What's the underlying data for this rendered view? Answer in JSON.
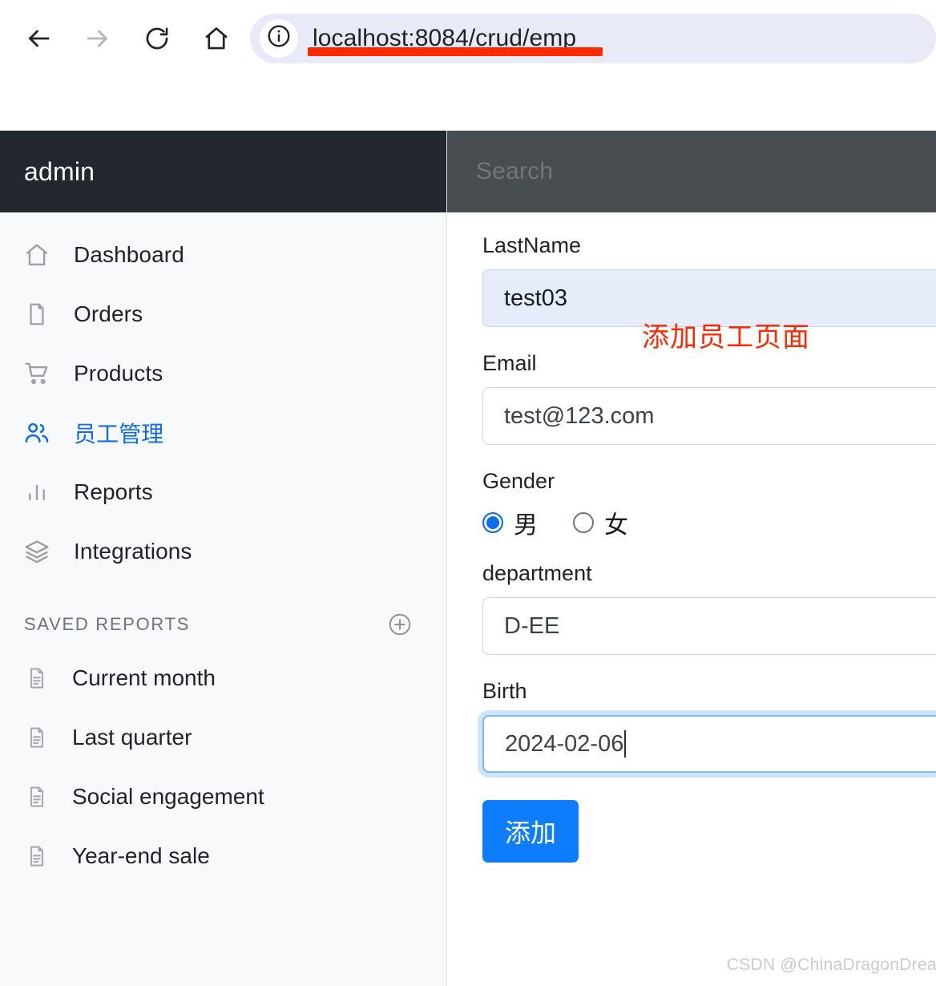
{
  "browser": {
    "back_icon": "arrow-left-icon",
    "forward_icon": "arrow-right-icon",
    "reload_icon": "reload-icon",
    "home_icon": "home-icon",
    "site_info_icon": "info-circle-icon",
    "url": "localhost:8084/crud/emp",
    "highlight_color": "#fb2800"
  },
  "sidebar": {
    "brand": "admin",
    "items": [
      {
        "label": "Dashboard",
        "icon": "home-icon",
        "active": false
      },
      {
        "label": "Orders",
        "icon": "file-icon",
        "active": false
      },
      {
        "label": "Products",
        "icon": "shopping-cart-icon",
        "active": false
      },
      {
        "label": "员工管理",
        "icon": "users-icon",
        "active": true
      },
      {
        "label": "Reports",
        "icon": "bar-chart-icon",
        "active": false
      },
      {
        "label": "Integrations",
        "icon": "layers-icon",
        "active": false
      }
    ],
    "section": {
      "title": "SAVED REPORTS",
      "add_icon": "plus-circle-icon",
      "reports": [
        {
          "label": "Current month",
          "icon": "document-icon"
        },
        {
          "label": "Last quarter",
          "icon": "document-icon"
        },
        {
          "label": "Social engagement",
          "icon": "document-icon"
        },
        {
          "label": "Year-end sale",
          "icon": "document-icon"
        }
      ]
    },
    "accent_color": "#0b6cf0",
    "header_bg": "#23282e"
  },
  "topbar": {
    "search_placeholder": "Search",
    "bg": "#484d51"
  },
  "form": {
    "annotation": "添加员工页面",
    "annotation_color": "#fe2900",
    "fields": {
      "lastname": {
        "label": "LastName",
        "value": "test03",
        "placeholder": "LastName"
      },
      "email": {
        "label": "Email",
        "value": "test@123.com",
        "placeholder": "Email"
      },
      "gender": {
        "label": "Gender",
        "selected": "男",
        "options": [
          {
            "label": "男",
            "checked": true
          },
          {
            "label": "女",
            "checked": false
          }
        ]
      },
      "department": {
        "label": "department",
        "value": "D-EE",
        "placeholder": "department"
      },
      "birth": {
        "label": "Birth",
        "value": "2024-02-06",
        "placeholder": "Birth"
      }
    },
    "submit_label": "添加",
    "submit_color": "#0d7dfb"
  },
  "watermark": "CSDN @ChinaDragonDreamer"
}
